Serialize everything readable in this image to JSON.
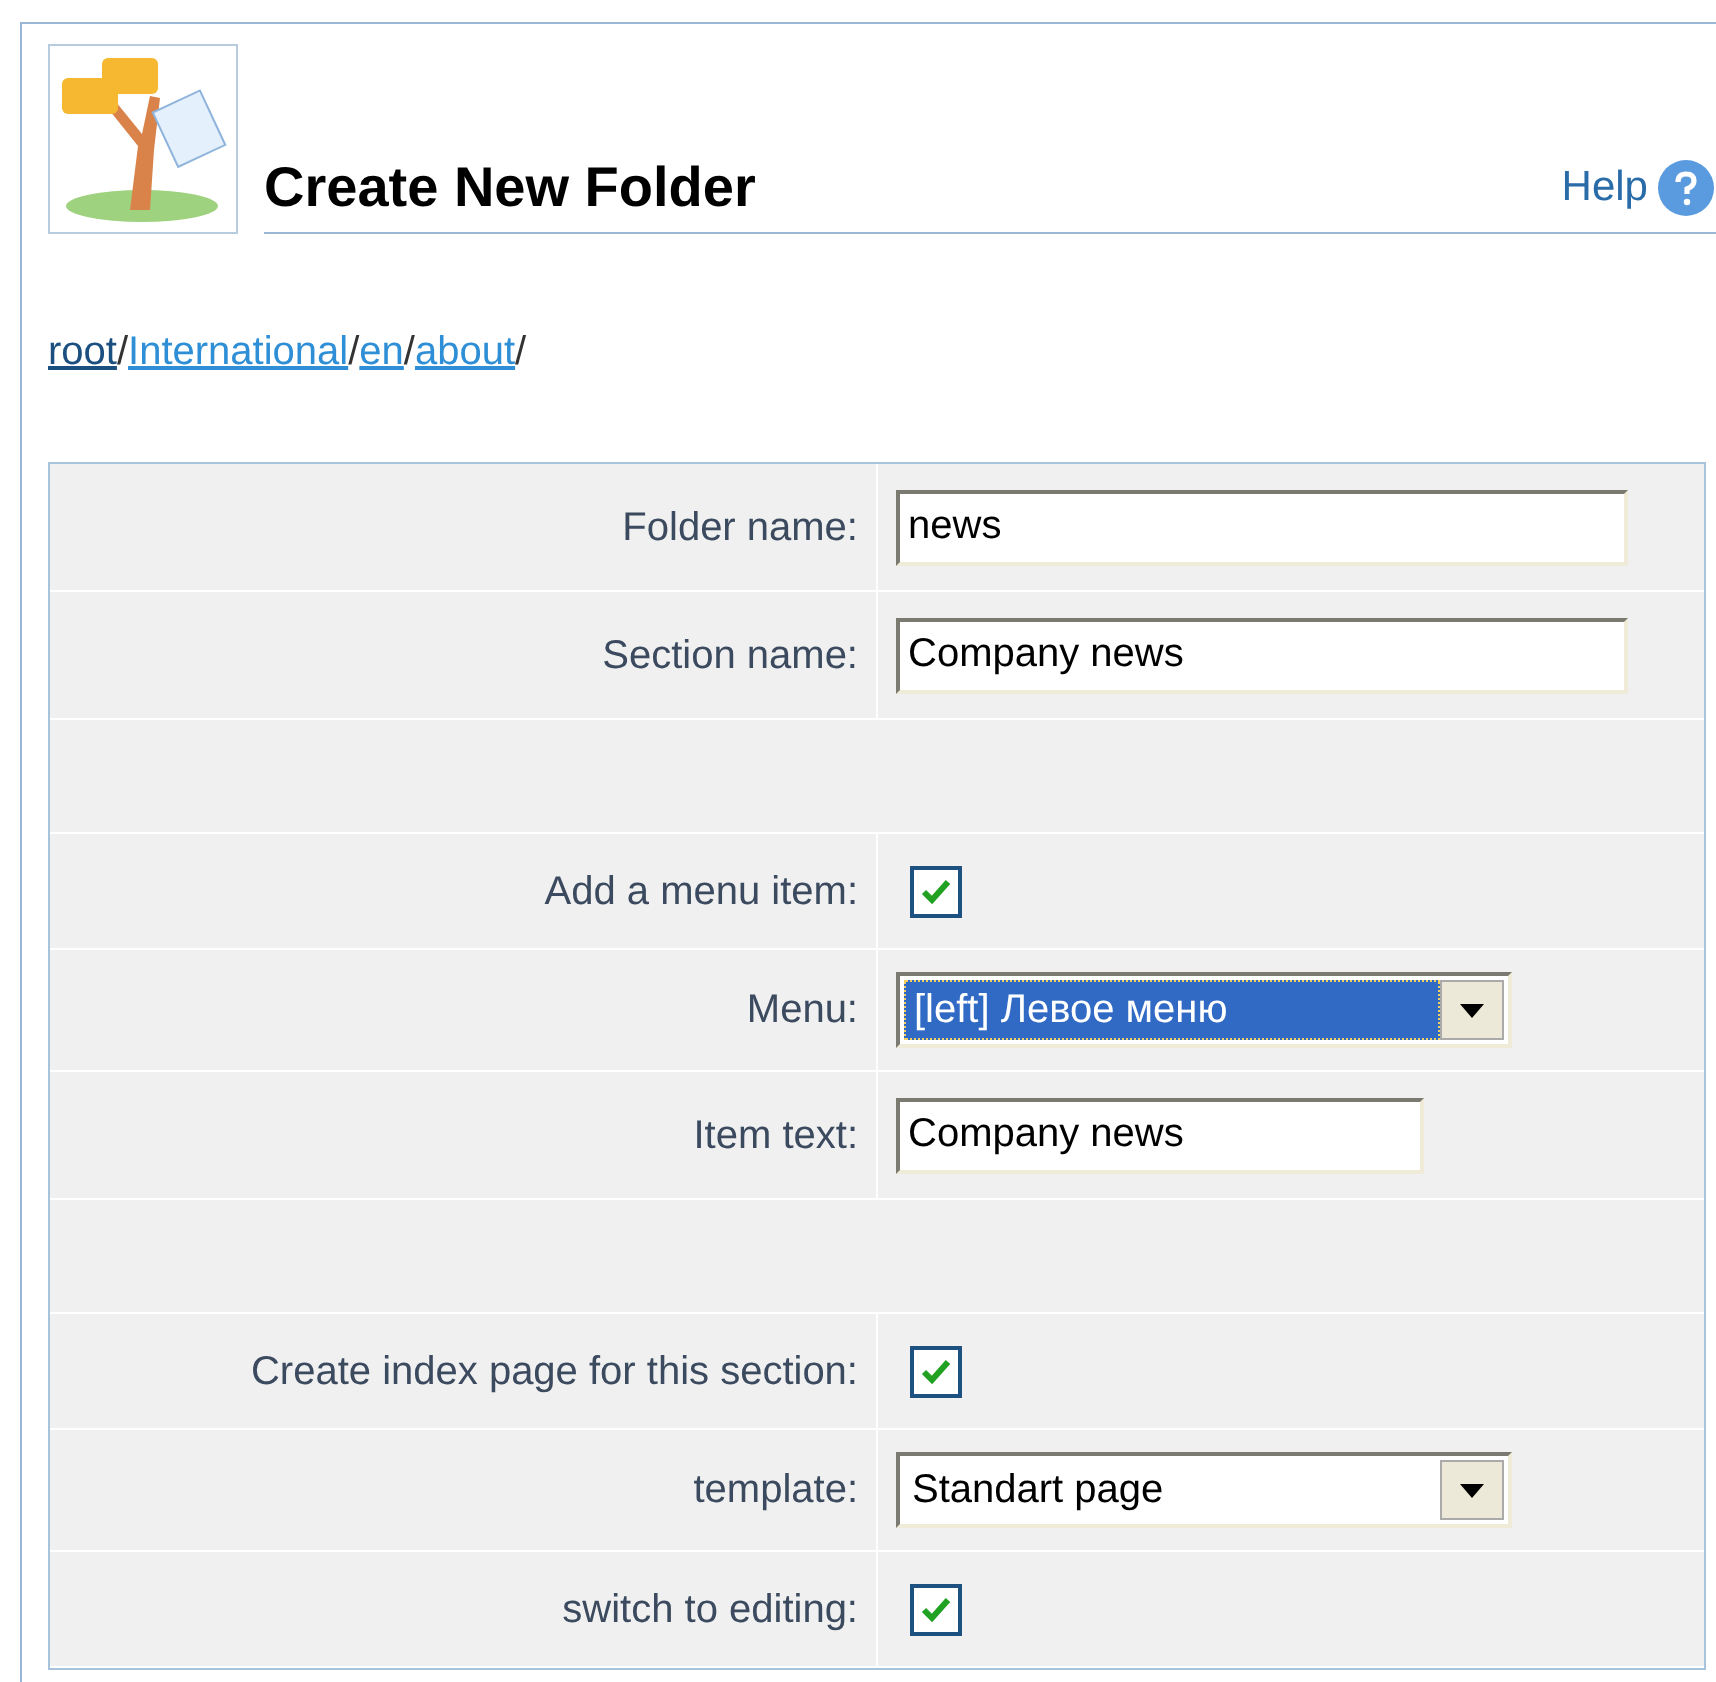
{
  "header": {
    "title": "Create New Folder",
    "help": "Help"
  },
  "breadcrumb": [
    "root",
    "International",
    "en",
    "about"
  ],
  "breadcrumb_separator": "/",
  "form": {
    "rows": [
      {
        "kind": "text",
        "label": "Folder name:",
        "value": "news",
        "wide": true
      },
      {
        "kind": "text",
        "label": "Section name:",
        "value": "Company news",
        "wide": true
      },
      {
        "kind": "spacer"
      },
      {
        "kind": "checkbox",
        "label": "Add a menu item:",
        "checked": true
      },
      {
        "kind": "select",
        "label": "Menu:",
        "value": "[left] Левое меню",
        "focused": true
      },
      {
        "kind": "text",
        "label": "Item text:",
        "value": "Company news",
        "wide": false
      },
      {
        "kind": "spacer"
      },
      {
        "kind": "checkbox",
        "label": "Create index page for this section:",
        "checked": true
      },
      {
        "kind": "select",
        "label": "template:",
        "value": "Standart page",
        "focused": false
      },
      {
        "kind": "checkbox",
        "label": "switch to editing:",
        "checked": true
      }
    ]
  }
}
